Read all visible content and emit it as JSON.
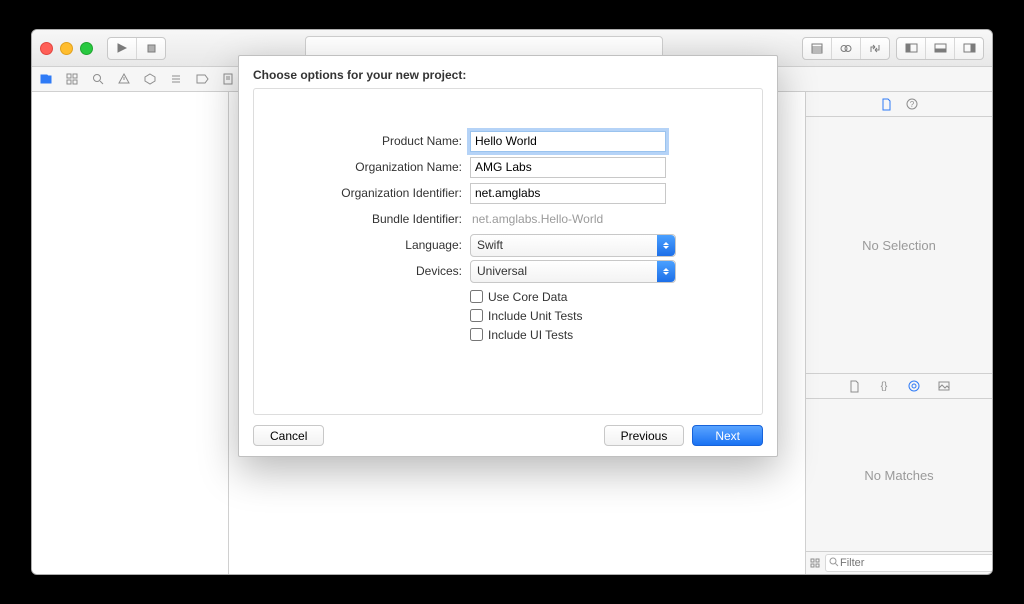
{
  "sheet": {
    "title": "Choose options for your new project:",
    "labels": {
      "product_name": "Product Name:",
      "org_name": "Organization Name:",
      "org_id": "Organization Identifier:",
      "bundle_id": "Bundle Identifier:",
      "language": "Language:",
      "devices": "Devices:"
    },
    "values": {
      "product_name": "Hello World",
      "org_name": "AMG Labs",
      "org_id": "net.amglabs",
      "bundle_id": "net.amglabs.Hello-World",
      "language": "Swift",
      "devices": "Universal"
    },
    "checks": {
      "core_data": "Use Core Data",
      "unit_tests": "Include Unit Tests",
      "ui_tests": "Include UI Tests"
    },
    "buttons": {
      "cancel": "Cancel",
      "previous": "Previous",
      "next": "Next"
    }
  },
  "inspector": {
    "no_selection": "No Selection",
    "no_matches": "No Matches",
    "filter_placeholder": "Filter"
  }
}
